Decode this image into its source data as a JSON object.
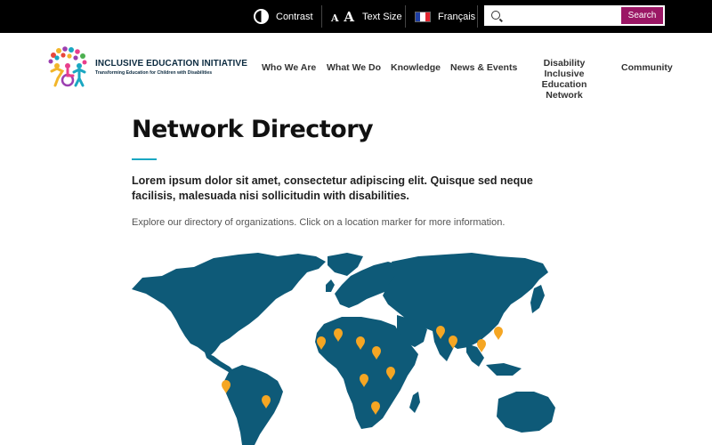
{
  "topbar": {
    "contrast_label": "Contrast",
    "textsize_label": "Text Size",
    "textsize_icon": "A A",
    "language_label": "Français",
    "search_placeholder": "",
    "search_button": "Search"
  },
  "logo": {
    "title": "INCLUSIVE EDUCATION INITIATIVE",
    "subtitle": "Transforming Education for Children with Disabilities"
  },
  "nav": {
    "items": [
      "Who We Are",
      "What We Do",
      "Knowledge",
      "News & Events",
      "Disability Inclusive Education Network",
      "Community"
    ]
  },
  "main": {
    "title": "Network Directory",
    "lead": "Lorem ipsum dolor sit amet, consectetur adipiscing elit. Quisque sed neque facilisis, malesuada nisi sollicitudin with disabilities.",
    "intro": "Explore our directory of organizations. Click on a location marker for more information."
  },
  "colors": {
    "topbar_bg": "#000000",
    "accent": "#9b1765",
    "rule": "#1aa7c2",
    "map_land": "#0e5a78",
    "marker": "#f5a623"
  },
  "map": {
    "marker_count": 13
  }
}
